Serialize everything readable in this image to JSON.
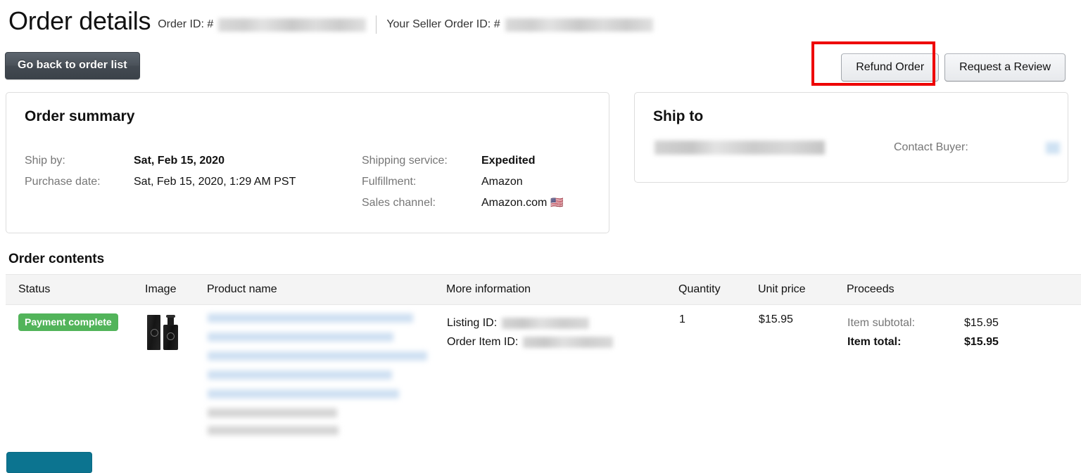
{
  "header": {
    "title": "Order details",
    "order_id_label": "Order ID: #",
    "order_id_value_redacted": "",
    "seller_order_id_label": "Your Seller Order ID: #",
    "seller_order_id_value_redacted": ""
  },
  "toolbar": {
    "back_label": "Go back to order list",
    "refund_label": "Refund Order",
    "request_review_label": "Request a Review",
    "highlight_color": "#ee0000",
    "highlight_target": "Refund Order"
  },
  "order_summary": {
    "title": "Order summary",
    "left": [
      {
        "key": "Ship by:",
        "value": "Sat, Feb 15, 2020",
        "accent": true
      },
      {
        "key": "Purchase date:",
        "value": "Sat, Feb 15, 2020, 1:29 AM PST",
        "accent": false
      }
    ],
    "right": [
      {
        "key": "Shipping service:",
        "value": "Expedited",
        "accent": true
      },
      {
        "key": "Fulfillment:",
        "value": "Amazon",
        "accent": false
      },
      {
        "key": "Sales channel:",
        "value": "Amazon.com",
        "accent": false,
        "flag": "🇺🇸"
      }
    ],
    "accent_color": "#c45500"
  },
  "ship_to": {
    "title": "Ship to",
    "address_redacted": "",
    "contact_buyer_label": "Contact Buyer:",
    "contact_buyer_value_redacted": ""
  },
  "order_contents": {
    "title": "Order contents",
    "columns": [
      "Status",
      "Image",
      "Product name",
      "More information",
      "Quantity",
      "Unit price",
      "Proceeds"
    ],
    "rows": [
      {
        "status": "Payment complete",
        "status_color": "#52b45a",
        "image_alt": "black box and black spray bottle product photo",
        "product_name_redacted": "",
        "listing_id_label": "Listing ID:",
        "listing_id_redacted": "",
        "order_item_id_label": "Order Item ID:",
        "order_item_id_redacted": "",
        "quantity": "1",
        "unit_price": "$15.95",
        "proceeds": [
          {
            "key": "Item subtotal:",
            "value": "$15.95",
            "bold": false
          },
          {
            "key": "Item total:",
            "value": "$15.95",
            "bold": true
          }
        ]
      }
    ]
  },
  "footer": {
    "teal_button_label": "",
    "teal_button_color": "#0c7490"
  }
}
